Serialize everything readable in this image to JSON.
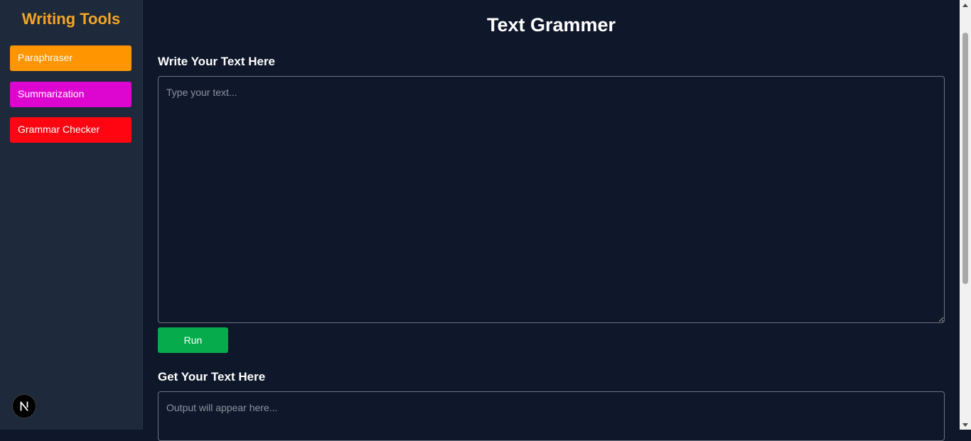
{
  "sidebar": {
    "title": "Writing Tools",
    "items": [
      {
        "label": "Paraphraser",
        "color": "#ff9500"
      },
      {
        "label": "Summarization",
        "color": "#dd06d0"
      },
      {
        "label": "Grammar Checker",
        "color": "#ff0512"
      }
    ],
    "badge_letter": "N"
  },
  "main": {
    "title": "Text Grammer",
    "input_label": "Write Your Text Here",
    "input_placeholder": "Type your text...",
    "run_label": "Run",
    "output_label": "Get Your Text Here",
    "output_placeholder": "Output will appear here..."
  },
  "colors": {
    "background": "#0f172a",
    "sidebar_bg": "#1e293b",
    "brand": "#f5a623",
    "run_button": "#06ab4c"
  }
}
